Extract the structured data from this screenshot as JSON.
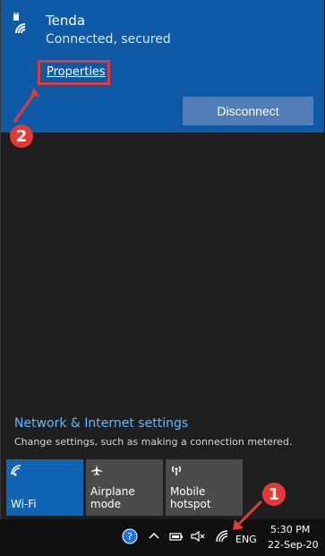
{
  "wifi": {
    "network_name": "Tenda",
    "status": "Connected, secured",
    "properties_label": "Properties",
    "disconnect_label": "Disconnect"
  },
  "annotations": {
    "step1": "1",
    "step2": "2"
  },
  "settings": {
    "link": "Network & Internet settings",
    "description": "Change settings, such as making a connection metered."
  },
  "quick_actions": [
    {
      "label": "Wi-Fi"
    },
    {
      "label": "Airplane mode"
    },
    {
      "label": "Mobile\nhotspot"
    }
  ],
  "taskbar": {
    "language": "ENG",
    "time": "5:30 PM",
    "date": "22-Sep-20"
  },
  "colors": {
    "accent": "#0f5aa6",
    "annotation_red": "#e53935",
    "link_blue": "#65b7ff"
  }
}
